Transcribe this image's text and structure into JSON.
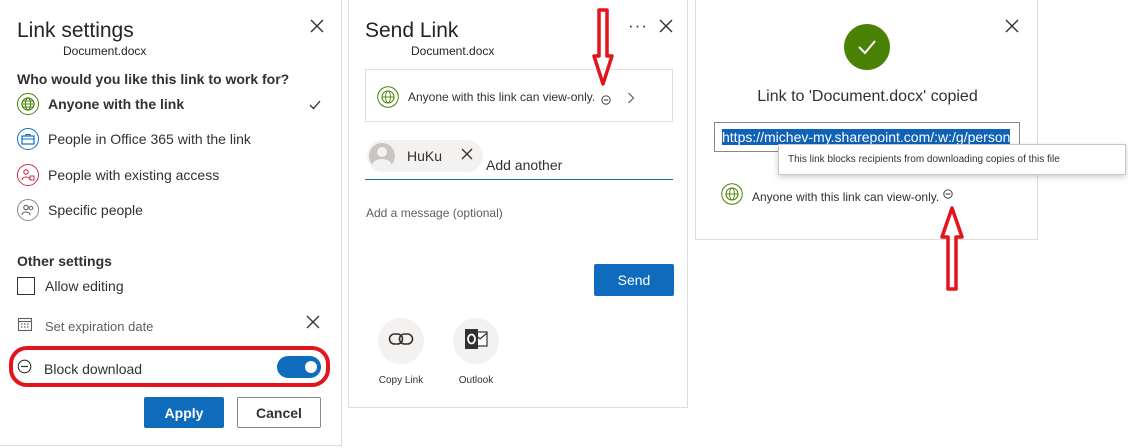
{
  "link_settings": {
    "title": "Link settings",
    "file_name": "Document.docx",
    "question": "Who would you like this link to work for?",
    "options": [
      {
        "label": "Anyone with the link",
        "selected": true,
        "icon": "globe-icon",
        "color": "#498205"
      },
      {
        "label": "People in Office 365 with the link",
        "selected": false,
        "icon": "briefcase-icon",
        "color": "#0f6cbd"
      },
      {
        "label": "People with existing access",
        "selected": false,
        "icon": "group-lock-icon",
        "color": "#c4314b"
      },
      {
        "label": "Specific people",
        "selected": false,
        "icon": "people-icon",
        "color": "#605e5c"
      }
    ],
    "other_settings_title": "Other settings",
    "allow_editing": {
      "label": "Allow editing",
      "checked": false
    },
    "expiration": {
      "label": "Set expiration date"
    },
    "block_download": {
      "label": "Block download",
      "on": true
    },
    "apply_label": "Apply",
    "cancel_label": "Cancel"
  },
  "send_link": {
    "title": "Send Link",
    "more_label": "···",
    "file_name": "Document.docx",
    "permission_text": "Anyone with this link can view-only.",
    "recipient": {
      "name": "HuKu"
    },
    "add_another_label": "Add another",
    "message_placeholder": "Add a message (optional)",
    "send_label": "Send",
    "share_options": [
      {
        "label": "Copy Link",
        "icon": "link-icon"
      },
      {
        "label": "Outlook",
        "icon": "outlook-icon"
      }
    ]
  },
  "copied": {
    "title": "Link to 'Document.docx' copied",
    "url": "https://michev-my.sharepoint.com/:w:/g/person",
    "tooltip": "This link blocks recipients from downloading copies of this file",
    "permission_text": "Anyone with this link can view-only."
  },
  "colors": {
    "accent": "#0f6cbd",
    "success": "#498205",
    "annotation_red": "#e3141c"
  }
}
